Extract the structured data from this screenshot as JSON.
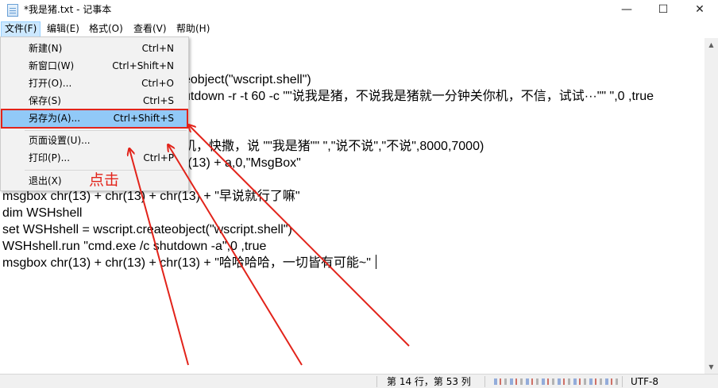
{
  "window": {
    "title": "*我是猪.txt - 记事本",
    "min_glyph": "—",
    "max_glyph": "☐",
    "close_glyph": "✕"
  },
  "menubar": {
    "file": "文件(F)",
    "edit": "编辑(E)",
    "format": "格式(O)",
    "view": "查看(V)",
    "help": "帮助(H)"
  },
  "file_menu": {
    "new": {
      "label": "新建(N)",
      "shortcut": "Ctrl+N"
    },
    "new_window": {
      "label": "新窗口(W)",
      "shortcut": "Ctrl+Shift+N"
    },
    "open": {
      "label": "打开(O)...",
      "shortcut": "Ctrl+O"
    },
    "save": {
      "label": "保存(S)",
      "shortcut": "Ctrl+S"
    },
    "save_as": {
      "label": "另存为(A)...",
      "shortcut": "Ctrl+Shift+S"
    },
    "page_setup": {
      "label": "页面设置(U)...",
      "shortcut": ""
    },
    "print": {
      "label": "打印(P)...",
      "shortcut": "Ctrl+P"
    },
    "exit": {
      "label": "退出(X)",
      "shortcut": ""
    }
  },
  "editor": {
    "lines": [
      "eobject(\"wscript.shell\")",
      "utdown -r -t 60 -c \"\"说我是猪，不说我是猪就一分钟关你机，不信，试试···\"\" \",0 ,true",
      "机，快撒，说 \"\"我是猪\"\" \",\"说不说\",\"不说\",8000,7000)",
      "r(13) + a,0,\"MsgBox\"",
      "msgbox chr(13) + chr(13) + chr(13) + \"早说就行了嘛\"",
      "dim WSHshell",
      "set WSHshell = wscript.createobject(\"wscript.shell\")",
      "WSHshell.run \"cmd.exe /c shutdown -a\",0 ,true",
      "msgbox chr(13) + chr(13) + chr(13) + \"哈哈哈哈，一切皆有可能~\" "
    ]
  },
  "annotation": {
    "click_label": "点击",
    "color": "#e2231a"
  },
  "statusbar": {
    "position": "第 14 行，第 53 列",
    "encoding": "UTF-8"
  },
  "colors": {
    "menu_open_bg": "#cce8ff",
    "hover_bg": "#91c9f7",
    "highlight_border": "#e2231a"
  }
}
